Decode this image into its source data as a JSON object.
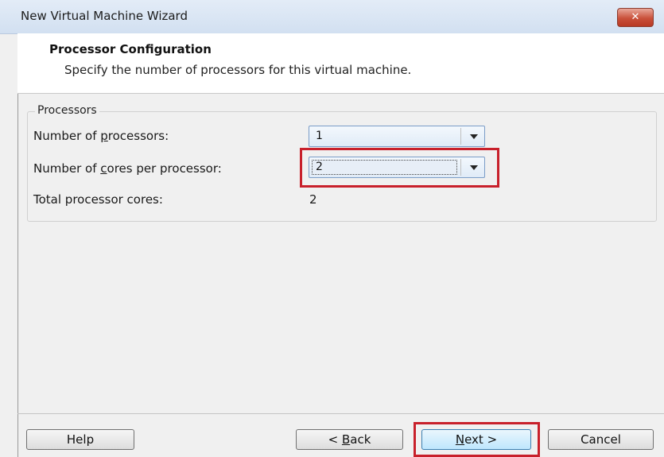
{
  "window": {
    "title": "New Virtual Machine Wizard",
    "close_symbol": "✕"
  },
  "header": {
    "title": "Processor Configuration",
    "subtitle": "Specify the number of processors for this virtual machine."
  },
  "processors": {
    "group_label": "Processors",
    "num_processors": {
      "label_pre": "Number of ",
      "label_mnemonic": "p",
      "label_post": "rocessors:",
      "value": "1"
    },
    "cores_per_processor": {
      "label_pre": "Number of ",
      "label_mnemonic": "c",
      "label_post": "ores per processor:",
      "value": "2"
    },
    "total_cores": {
      "label": "Total processor cores:",
      "value": "2"
    }
  },
  "buttons": {
    "help": "Help",
    "back_pre": "< ",
    "back_mnemonic": "B",
    "back_post": "ack",
    "next_mnemonic": "N",
    "next_post": "ext >",
    "cancel": "Cancel"
  },
  "colors": {
    "highlight": "#c8202b",
    "titlebar": "#d2e0f1",
    "close_button": "#c9503a"
  },
  "icons": {
    "close": "close-icon",
    "dropdown": "chevron-down-icon"
  }
}
